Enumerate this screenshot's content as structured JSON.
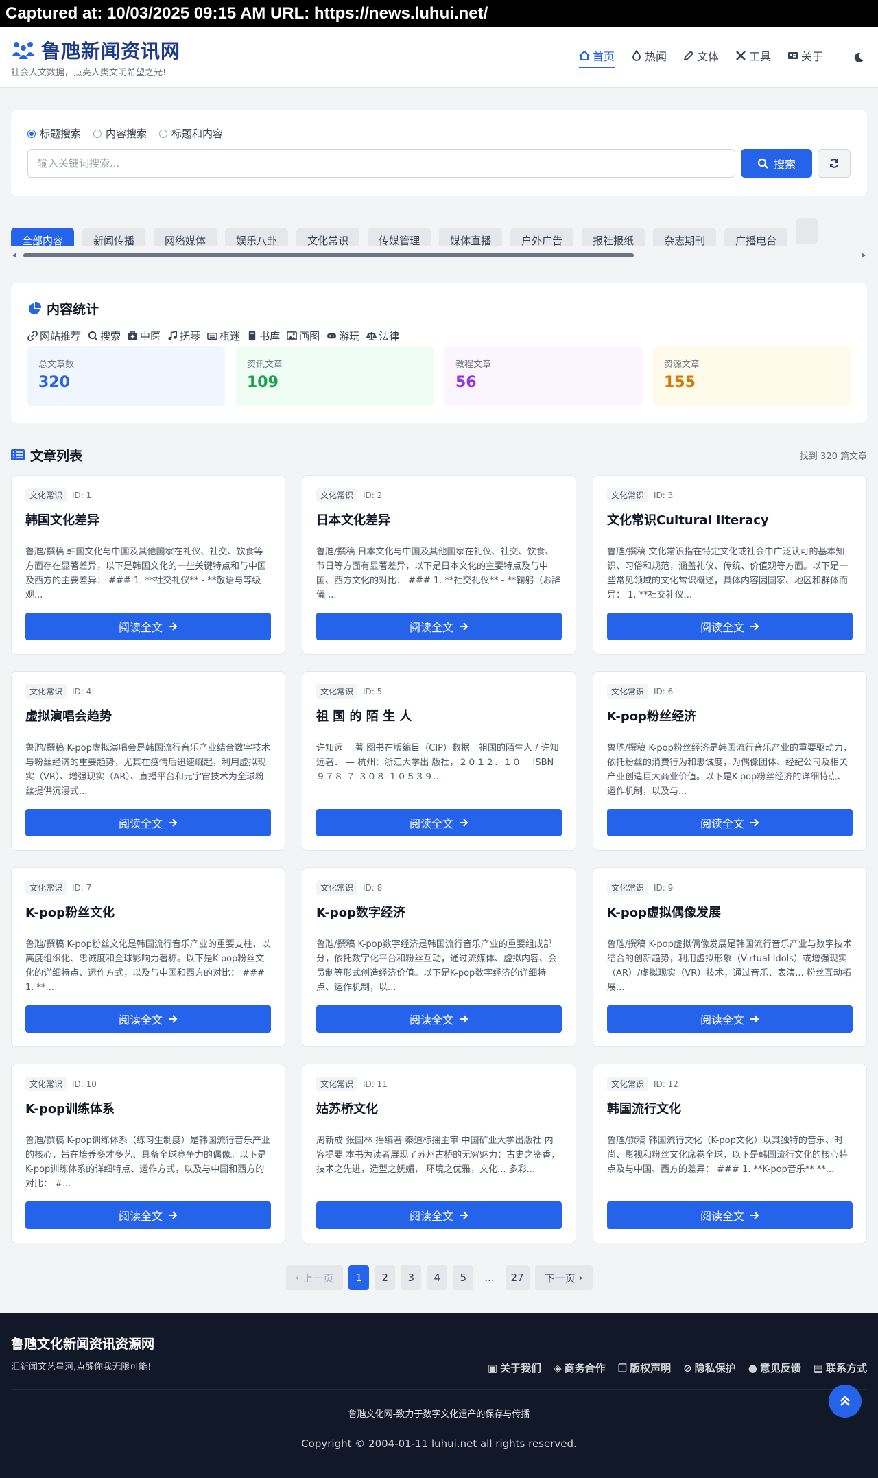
{
  "capture": {
    "text": "Captured at: 10/03/2025 09:15 AM    URL: https://news.luhui.net/"
  },
  "header": {
    "title": "鲁虺新闻资讯网",
    "subtitle": "社会人文数据，点亮人类文明希望之光!",
    "nav": [
      {
        "label": "首页",
        "icon": "home-icon",
        "active": true
      },
      {
        "label": "热闻",
        "icon": "fire-icon"
      },
      {
        "label": "文体",
        "icon": "pen-icon"
      },
      {
        "label": "工具",
        "icon": "tools-icon"
      },
      {
        "label": "关于",
        "icon": "id-card-icon"
      }
    ],
    "theme_icon": "moon-icon"
  },
  "search": {
    "options": [
      "标题搜索",
      "内容搜索",
      "标题和内容"
    ],
    "selected": "标题搜索",
    "placeholder": "输入关键词搜索...",
    "button_label": "搜索"
  },
  "categories": [
    "全部内容",
    "新闻传播",
    "网络媒体",
    "娱乐八卦",
    "文化常识",
    "传媒管理",
    "媒体直播",
    "户外广告",
    "报社报纸",
    "杂志期刊",
    "广播电台"
  ],
  "stats": {
    "title": "内容统计",
    "links": [
      "网站推荐",
      "搜索",
      "中医",
      "抚琴",
      "棋迷",
      "书库",
      "画图",
      "游玩",
      "法律"
    ],
    "boxes": [
      {
        "label": "总文章数",
        "value": "320",
        "color": "#2563eb",
        "bg": "#eff6ff"
      },
      {
        "label": "资讯文章",
        "value": "109",
        "color": "#16a34a",
        "bg": "#f0fdf4"
      },
      {
        "label": "教程文章",
        "value": "56",
        "color": "#9333ea",
        "bg": "#faf5ff"
      },
      {
        "label": "资源文章",
        "value": "155",
        "color": "#d97706",
        "bg": "#fffbeb"
      }
    ]
  },
  "list": {
    "title": "文章列表",
    "count_text": "找到 320 篇文章",
    "read_label": "阅读全文",
    "articles": [
      {
        "tag": "文化常识",
        "id": "ID: 1",
        "title": "韩国文化差异",
        "summary": "鲁虺/撰稿 韩国文化与中国及其他国家在礼仪、社交、饮食等方面存在显著差异，以下是韩国文化的一些关键特点和与中国及西方的主要差异： ### 1. **社交礼仪** - **敬语与等级观..."
      },
      {
        "tag": "文化常识",
        "id": "ID: 2",
        "title": "日本文化差异",
        "summary": "鲁虺/撰稿 日本文化与中国及其他国家在礼仪、社交、饮食、节日等方面有显著差异，以下是日本文化的主要特点及与中国、西方文化的对比： ### 1. **社交礼仪** - **鞠躬（お辞儀 ..."
      },
      {
        "tag": "文化常识",
        "id": "ID: 3",
        "title": "文化常识Cultural literacy",
        "summary": "鲁虺/撰稿 文化常识指在特定文化或社会中广泛认可的基本知识、习俗和规范，涵盖礼仪、传统、价值观等方面。以下是一些常见领域的文化常识概述，具体内容因国家、地区和群体而异： 1. **社交礼仪..."
      },
      {
        "tag": "文化常识",
        "id": "ID: 4",
        "title": "虚拟演唱会趋势",
        "summary": "鲁虺/撰稿 K-pop虚拟演唱会是韩国流行音乐产业结合数字技术与粉丝经济的重要趋势，尤其在疫情后迅速崛起，利用虚拟现实（VR）、增强现实（AR）、直播平台和元宇宙技术为全球粉丝提供沉浸式..."
      },
      {
        "tag": "文化常识",
        "id": "ID: 5",
        "title": "祖 国 的 陌 生 人",
        "summary": "许知远　 著 图书在版编目（CIP）数据　祖国的陌生人 / 许知远著． — 杭州：浙江大学出 版社，２０１２．１０　 ISBN ９７８-７-３０８-１０５３９..."
      },
      {
        "tag": "文化常识",
        "id": "ID: 6",
        "title": "K-pop粉丝经济",
        "summary": "鲁虺/撰稿 K-pop粉丝经济是韩国流行音乐产业的重要驱动力，依托粉丝的消费行为和忠诚度，为偶像团体、经纪公司及相关产业创造巨大商业价值。以下是K-pop粉丝经济的详细特点、运作机制，以及与..."
      },
      {
        "tag": "文化常识",
        "id": "ID: 7",
        "title": "K-pop粉丝文化",
        "summary": "鲁虺/撰稿 K-pop粉丝文化是韩国流行音乐产业的重要支柱，以高度组织化、忠诚度和全球影响力著称。以下是K-pop粉丝文化的详细特点、运作方式，以及与中国和西方的对比： ### 1. **..."
      },
      {
        "tag": "文化常识",
        "id": "ID: 8",
        "title": "K-pop数字经济",
        "summary": "鲁虺/撰稿 K-pop数字经济是韩国流行音乐产业的重要组成部分，依托数字化平台和粉丝互动，通过流媒体、虚拟内容、会员制等形式创造经济价值。以下是K-pop数字经济的详细特点、运作机制，以..."
      },
      {
        "tag": "文化常识",
        "id": "ID: 9",
        "title": "K-pop虚拟偶像发展",
        "summary": "鲁虺/撰稿 K-pop虚拟偶像发展是韩国流行音乐产业与数字技术结合的创新趋势，利用虚拟形象（Virtual Idols）或增强现实（AR）/虚拟现实（VR）技术，通过音乐、表演... 粉丝互动拓展..."
      },
      {
        "tag": "文化常识",
        "id": "ID: 10",
        "title": "K-pop训练体系",
        "summary": "鲁虺/撰稿 K-pop训练体系（练习生制度）是韩国流行音乐产业的核心，旨在培养多才多艺、具备全球竞争力的偶像。以下是K-pop训练体系的详细特点、运作方式，以及与中国和西方的对比： #..."
      },
      {
        "tag": "文化常识",
        "id": "ID: 11",
        "title": "姑苏桥文化",
        "summary": "周新成 张国林 摇编著 秦道标摇主审 中国矿业大学出版社 内容提要 本书为读者展现了苏州古桥的无穷魅力：古史之鉴香，技术之先进，造型之妩媚， 环境之优雅，文化... 多彩..."
      },
      {
        "tag": "文化常识",
        "id": "ID: 12",
        "title": "韩国流行文化",
        "summary": "鲁虺/撰稿 韩国流行文化（K-pop文化）以其独特的音乐、时尚、影视和粉丝文化席卷全球，以下是韩国流行文化的核心特点及与中国、西方的差异： ### 1. **K-pop音乐** **..."
      }
    ]
  },
  "pagination": {
    "prev": "上一页",
    "pages": [
      "1",
      "2",
      "3",
      "4",
      "5"
    ],
    "ellipsis": "...",
    "last": "27",
    "next": "下一页",
    "current": "1"
  },
  "footer": {
    "title": "鲁虺文化新闻资讯资源网",
    "subtitle": "汇新闻文艺星河,点醒你我无限可能!",
    "links": [
      "关于我们",
      "商务合作",
      "版权声明",
      "隐私保护",
      "意见反馈",
      "联系方式"
    ],
    "tagline": "鲁虺文化网-致力于数字文化遗产的保存与传播",
    "copyright": "Copyright © 2004-01-11 luhui.net all rights reserved."
  }
}
